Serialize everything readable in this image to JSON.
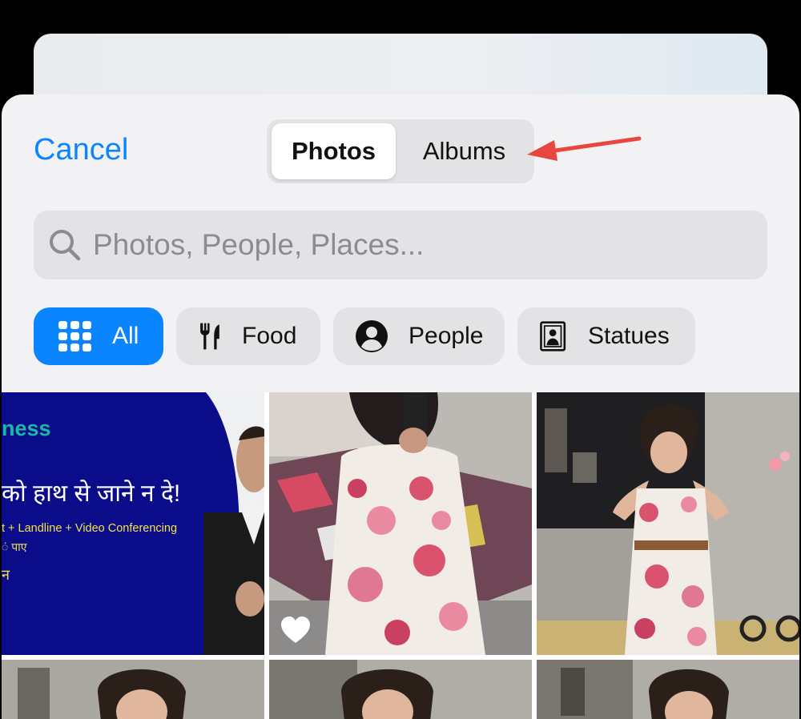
{
  "header": {
    "cancel_label": "Cancel",
    "segments": [
      {
        "label": "Photos",
        "selected": true
      },
      {
        "label": "Albums",
        "selected": false
      }
    ]
  },
  "search": {
    "placeholder": "Photos, People, Places..."
  },
  "filters": [
    {
      "label": "All",
      "icon": "grid-icon",
      "selected": true
    },
    {
      "label": "Food",
      "icon": "fork-knife-icon",
      "selected": false
    },
    {
      "label": "People",
      "icon": "person-circle-icon",
      "selected": false
    },
    {
      "label": "Statues",
      "icon": "portrait-frame-icon",
      "selected": false
    }
  ],
  "photos": {
    "first": {
      "lines": [
        "ness",
        "को हाथ से जाने न दे!",
        "t + Landline + Video Conferencing",
        "ं पाए",
        "न"
      ]
    },
    "second_favorited": true
  },
  "colors": {
    "accent": "#0a84ff",
    "arrow": "#e8473f",
    "sheet_bg": "#f2f2f4"
  }
}
